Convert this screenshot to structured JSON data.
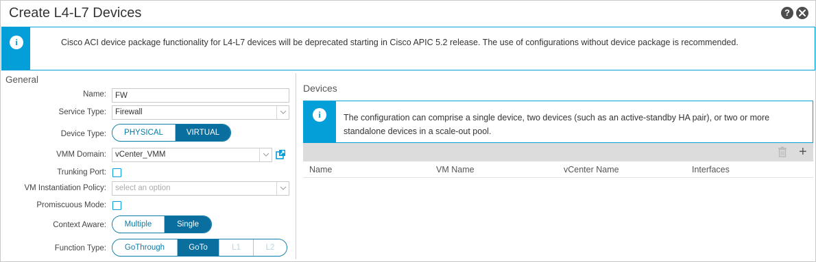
{
  "dialog": {
    "title": "Create L4-L7 Devices",
    "help_label": "?"
  },
  "banner": {
    "icon": "info-icon",
    "text": "Cisco ACI device package functionality for L4-L7 devices will be deprecated starting in Cisco APIC 5.2 release. The use of configurations without device package is recommended."
  },
  "general": {
    "section_label": "General",
    "name": {
      "label": "Name:",
      "value": "FW"
    },
    "service_type": {
      "label": "Service Type:",
      "value": "Firewall"
    },
    "device_type": {
      "label": "Device Type:",
      "options": [
        "PHYSICAL",
        "VIRTUAL"
      ],
      "selected": "VIRTUAL"
    },
    "vmm_domain": {
      "label": "VMM Domain:",
      "value": "vCenter_VMM"
    },
    "trunking_port": {
      "label": "Trunking Port:",
      "checked": false
    },
    "vm_instantiation_policy": {
      "label": "VM Instantiation Policy:",
      "placeholder": "select an option"
    },
    "promiscuous_mode": {
      "label": "Promiscuous Mode:",
      "checked": false
    },
    "context_aware": {
      "label": "Context Aware:",
      "options": [
        "Multiple",
        "Single"
      ],
      "selected": "Single"
    },
    "function_type": {
      "label": "Function Type:",
      "options": [
        "GoThrough",
        "GoTo",
        "L1",
        "L2"
      ],
      "selected": "GoTo",
      "disabled": [
        "L1",
        "L2"
      ]
    }
  },
  "devices": {
    "section_label": "Devices",
    "info_text": "The configuration can comprise a single device, two devices (such as an active-standby HA pair), or two or more standalone devices in a scale-out pool.",
    "toolbar": {
      "delete_icon": "trash-icon",
      "add_icon": "plus-icon"
    },
    "columns": [
      "Name",
      "VM Name",
      "vCenter Name",
      "Interfaces"
    ],
    "rows": []
  },
  "colors": {
    "info_blue": "#049fd9",
    "segment_active": "#0a6e9e",
    "toolbar_gray": "#dcdcdc"
  }
}
